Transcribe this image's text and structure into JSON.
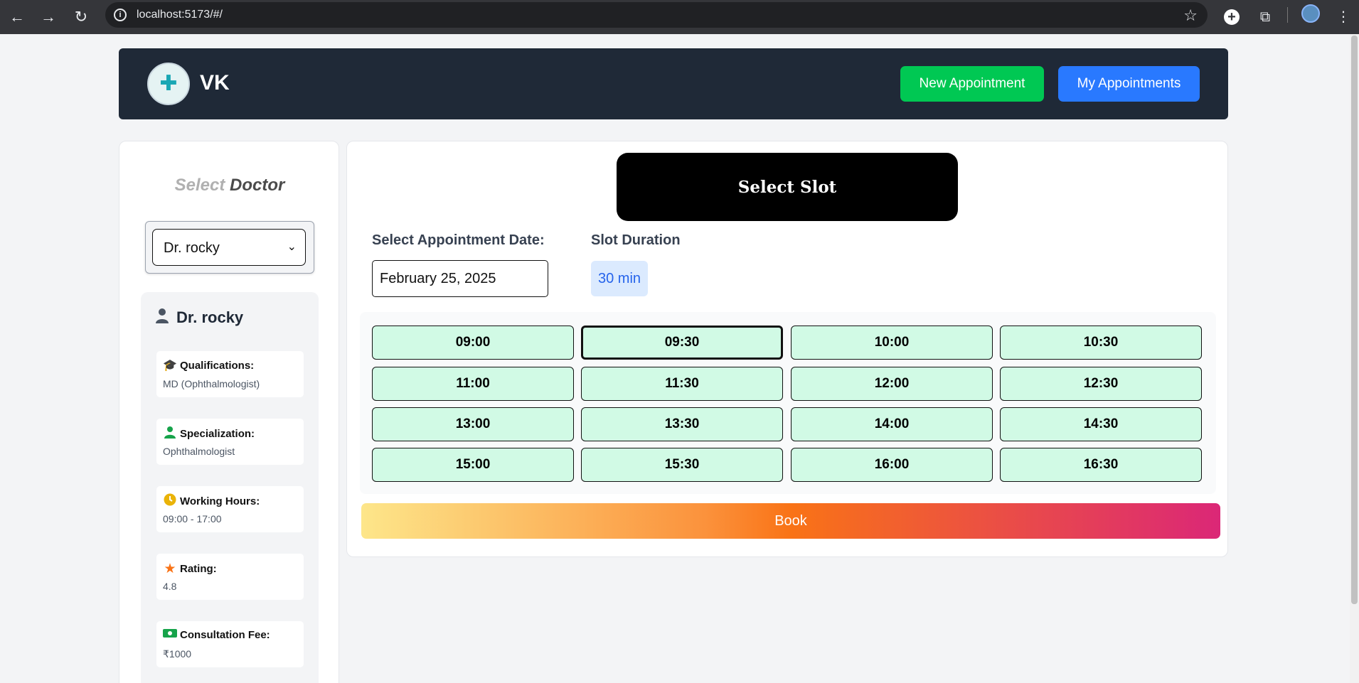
{
  "browser": {
    "url": "localhost:5173/#/"
  },
  "header": {
    "brand": "VK",
    "new_appointment": "New Appointment",
    "my_appointments": "My Appointments"
  },
  "doctor_select": {
    "title_part1": "Select",
    "title_part2": "Doctor",
    "selected": "Dr. rocky"
  },
  "doctor": {
    "name": "Dr. rocky",
    "details": [
      {
        "label": "Qualifications:",
        "value": "MD (Ophthalmologist)",
        "icon": "graduation-cap-icon",
        "color": "#9333ea"
      },
      {
        "label": "Specialization:",
        "value": "Ophthalmologist",
        "icon": "doctor-icon",
        "color": "#16a34a"
      },
      {
        "label": "Working Hours:",
        "value": "09:00 - 17:00",
        "icon": "clock-icon",
        "color": "#eab308"
      },
      {
        "label": "Rating:",
        "value": "4.8",
        "icon": "star-icon",
        "color": "#f97316"
      },
      {
        "label": "Consultation Fee:",
        "value": "₹1000",
        "icon": "money-icon",
        "color": "#16a34a"
      }
    ]
  },
  "slot_panel": {
    "title": "Select Slot",
    "date_label": "Select Appointment Date:",
    "date_value": "February 25, 2025",
    "duration_label": "Slot Duration",
    "duration_value": "30 min",
    "selected_slot": "09:30",
    "slots": [
      "09:00",
      "09:30",
      "10:00",
      "10:30",
      "11:00",
      "11:30",
      "12:00",
      "12:30",
      "13:00",
      "13:30",
      "14:00",
      "14:30",
      "15:00",
      "15:30",
      "16:00",
      "16:30"
    ],
    "book": "Book"
  },
  "colors": {
    "header_bg": "#1f2937",
    "new_btn": "#00c853",
    "my_btn": "#2979ff",
    "slot_bg": "#d1fae5"
  }
}
